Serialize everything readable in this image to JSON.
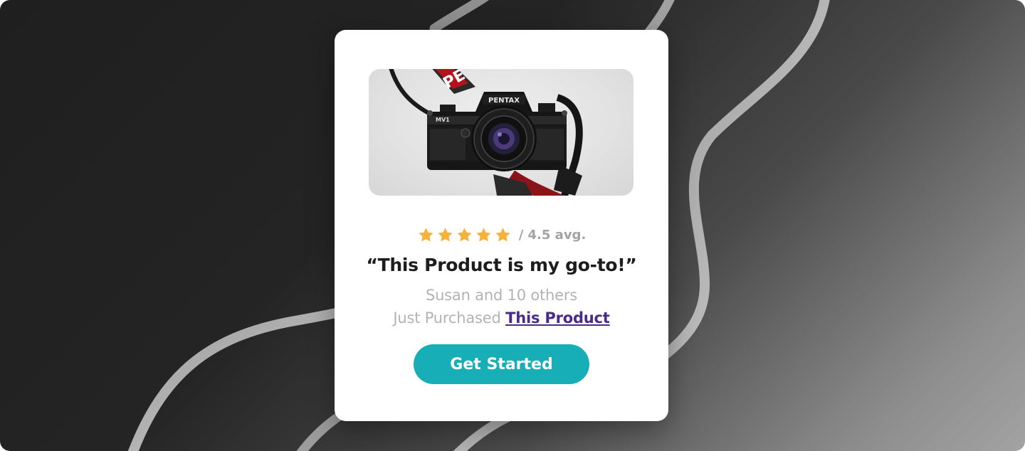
{
  "rating": {
    "stars": 5,
    "average_text": "/ 4.5 avg."
  },
  "testimonial": {
    "quote": "“This Product is my go-to!”"
  },
  "purchase": {
    "line1": "Susan and 10 others",
    "line2_prefix": "Just Purchased",
    "product_link": "This Product"
  },
  "cta": {
    "label": "Get Started"
  },
  "product_image": {
    "subject": "camera-photo",
    "camera_brand": "PENTAX",
    "camera_model": "MV1",
    "strap_text": "PE"
  },
  "colors": {
    "star": "#f6b23a",
    "cta_background": "#17aeb7",
    "link": "#4a2a8a",
    "muted_text": "#b3b3b3",
    "heading_text": "#1d1d1d"
  },
  "icons": [
    "star-icon"
  ]
}
